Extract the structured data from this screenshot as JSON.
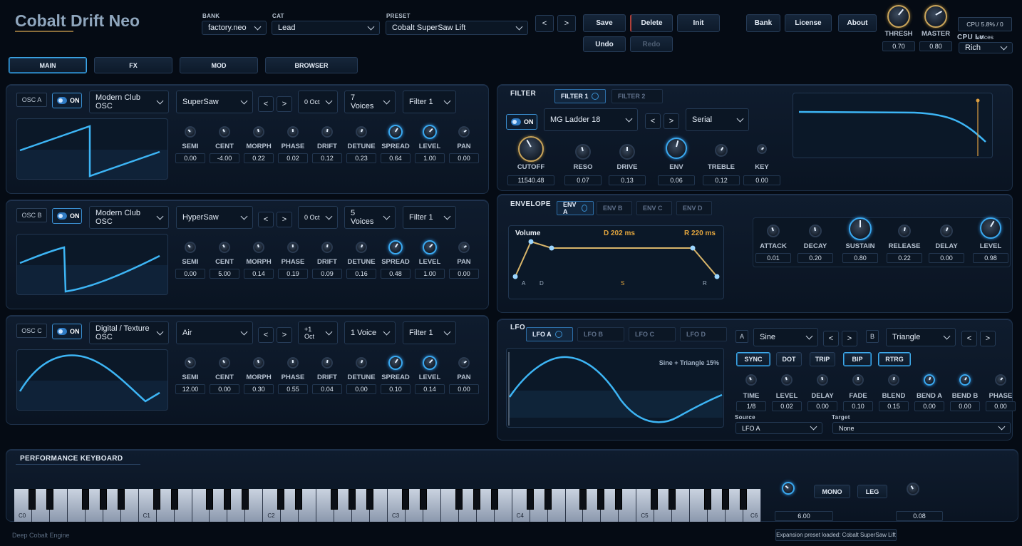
{
  "app": {
    "title": "Cobalt Drift Neo",
    "footer": "Deep Cobalt Engine",
    "status": "Expansion preset loaded: Cobalt SuperSaw Lift"
  },
  "header": {
    "bank_label": "BANK",
    "bank_value": "factory.neo",
    "cat_label": "CAT",
    "cat_value": "Lead",
    "preset_label": "PRESET",
    "preset_value": "Cobalt SuperSaw Lift",
    "prev": "<",
    "next": ">",
    "save": "Save",
    "delete": "Delete",
    "init": "Init",
    "undo": "Undo",
    "redo": "Redo",
    "bank_btn": "Bank",
    "license_btn": "License",
    "about_btn": "About",
    "thresh_label": "THRESH",
    "thresh_value": "0.70",
    "master_label": "MASTER",
    "master_value": "0.80",
    "cpu_text": "CPU 5.8% / 0 voices",
    "cpu_lv_label": "CPU Lv",
    "cpu_lv_value": "Rich"
  },
  "tabs": [
    "MAIN",
    "FX",
    "MOD",
    "BROWSER"
  ],
  "knob_labels": [
    "SEMI",
    "CENT",
    "MORPH",
    "PHASE",
    "DRIFT",
    "DETUNE",
    "SPREAD",
    "LEVEL",
    "PAN"
  ],
  "oscs": [
    {
      "name": "OSC A",
      "on": "ON",
      "type": "Modern Club OSC",
      "wave": "SuperSaw",
      "oct": "0 Oct",
      "voices": "7 Voices",
      "filter": "Filter 1",
      "values": [
        "0.00",
        "-4.00",
        "0.22",
        "0.02",
        "0.12",
        "0.23",
        "0.64",
        "1.00",
        "0.00"
      ]
    },
    {
      "name": "OSC B",
      "on": "ON",
      "type": "Modern Club OSC",
      "wave": "HyperSaw",
      "oct": "0 Oct",
      "voices": "5 Voices",
      "filter": "Filter 1",
      "values": [
        "0.00",
        "5.00",
        "0.14",
        "0.19",
        "0.09",
        "0.16",
        "0.48",
        "1.00",
        "0.00"
      ]
    },
    {
      "name": "OSC C",
      "on": "ON",
      "type": "Digital / Texture OSC",
      "wave": "Air",
      "oct": "+1 Oct",
      "voices": "1 Voice",
      "filter": "Filter 1",
      "values": [
        "12.00",
        "0.00",
        "0.30",
        "0.55",
        "0.04",
        "0.00",
        "0.10",
        "0.14",
        "0.00"
      ]
    }
  ],
  "filter": {
    "title": "FILTER",
    "tab1": "FILTER 1",
    "tab2": "FILTER 2",
    "on": "ON",
    "type": "MG Ladder 18",
    "routing": "Serial",
    "knobs": [
      {
        "label": "CUTOFF",
        "value": "11540.48"
      },
      {
        "label": "RESO",
        "value": "0.07"
      },
      {
        "label": "DRIVE",
        "value": "0.13"
      },
      {
        "label": "ENV",
        "value": "0.06"
      },
      {
        "label": "TREBLE",
        "value": "0.12"
      },
      {
        "label": "KEY",
        "value": "0.00"
      }
    ]
  },
  "envelope": {
    "title": "ENVELOPE",
    "tabs": [
      "ENV A",
      "ENV B",
      "ENV C",
      "ENV D"
    ],
    "display_title": "Volume",
    "decay_readout": "D 202 ms",
    "release_readout": "R 220 ms",
    "points": [
      "A",
      "D",
      "S",
      "R"
    ],
    "knobs": [
      {
        "label": "ATTACK",
        "value": "0.01"
      },
      {
        "label": "DECAY",
        "value": "0.20"
      },
      {
        "label": "SUSTAIN",
        "value": "0.80"
      },
      {
        "label": "RELEASE",
        "value": "0.22"
      },
      {
        "label": "DELAY",
        "value": "0.00"
      },
      {
        "label": "LEVEL",
        "value": "0.98"
      }
    ]
  },
  "lfo": {
    "title": "LFO",
    "tabs": [
      "LFO A",
      "LFO B",
      "LFO C",
      "LFO D"
    ],
    "display_text": "Sine + Triangle 15%",
    "a_label": "A",
    "a_shape": "Sine",
    "b_label": "B",
    "b_shape": "Triangle",
    "buttons": [
      "SYNC",
      "DOT",
      "TRIP",
      "BIP",
      "RTRG"
    ],
    "knobs": [
      {
        "label": "TIME",
        "value": "1/8"
      },
      {
        "label": "LEVEL",
        "value": "0.02"
      },
      {
        "label": "DELAY",
        "value": "0.00"
      },
      {
        "label": "FADE",
        "value": "0.10"
      },
      {
        "label": "BLEND",
        "value": "0.15"
      },
      {
        "label": "BEND A",
        "value": "0.00"
      },
      {
        "label": "BEND B",
        "value": "0.00"
      },
      {
        "label": "PHASE",
        "value": "0.00"
      }
    ],
    "source_label": "Source",
    "source_value": "LFO A",
    "target_label": "Target",
    "target_value": "None"
  },
  "keyboard": {
    "title": "PERFORMANCE KEYBOARD",
    "octaves": [
      "C0",
      "C1",
      "C2",
      "C3",
      "C4",
      "C5",
      "C6"
    ],
    "mono": "MONO",
    "leg": "LEG",
    "left_value": "6.00",
    "right_value": "0.08"
  }
}
